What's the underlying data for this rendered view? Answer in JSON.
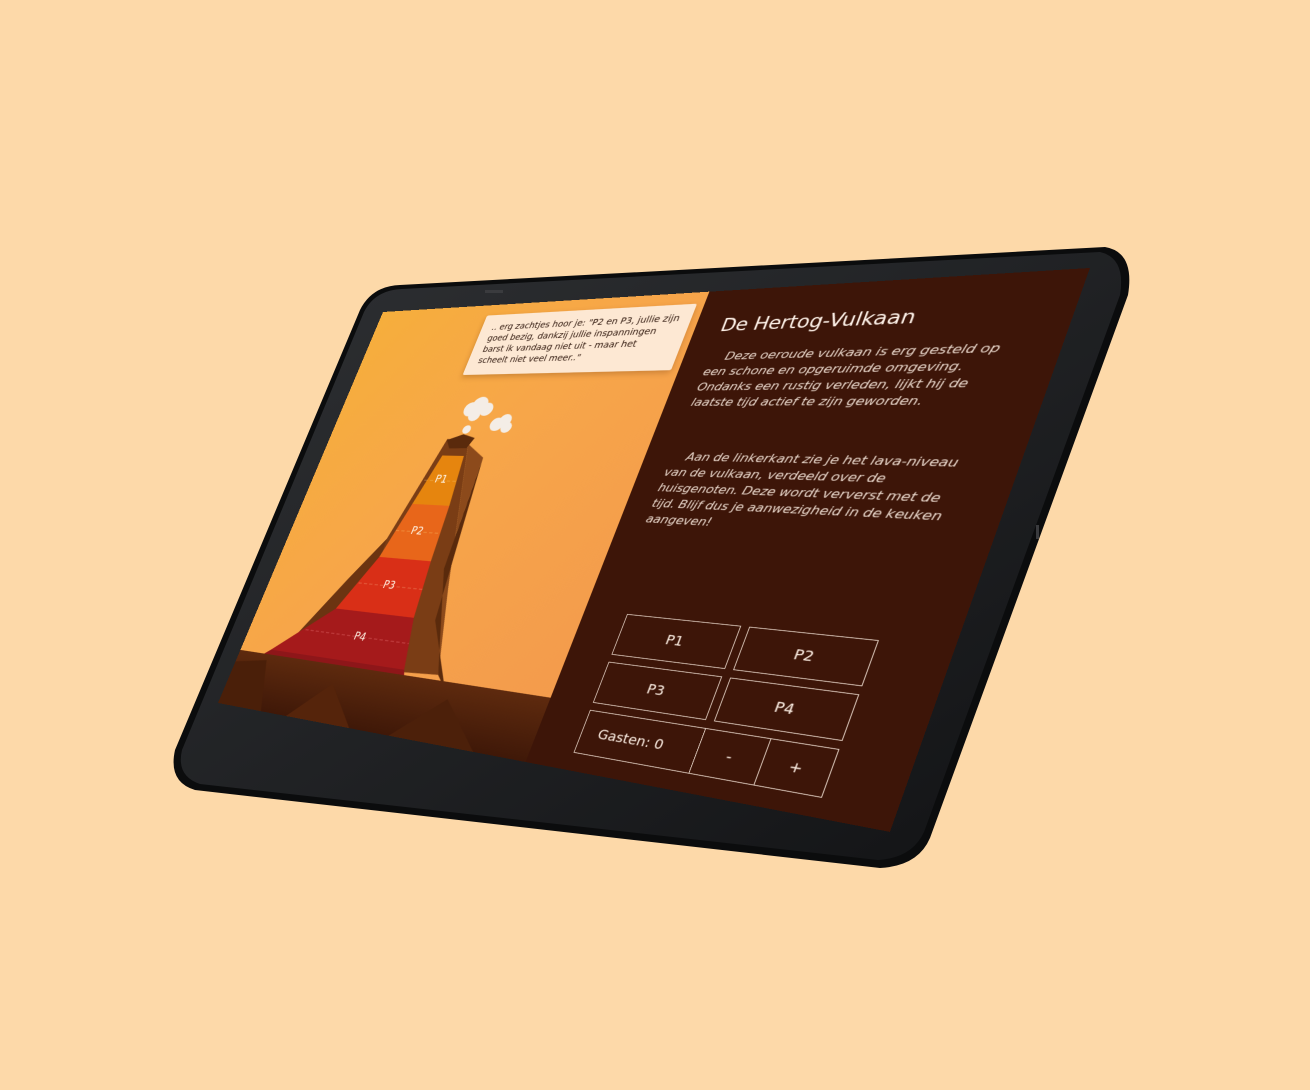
{
  "speech_bubble": {
    "text": ".. erg zachtjes hoor je: \"P2 en P3, jullie zijn goed bezig, dankzij jullie inspanningen barst ik vandaag niet uit - maar het scheelt niet veel meer..\""
  },
  "lava_levels": [
    {
      "label": "P1"
    },
    {
      "label": "P2"
    },
    {
      "label": "P3"
    },
    {
      "label": "P4"
    }
  ],
  "info": {
    "title": "De Hertog-Vulkaan",
    "paragraph1": "Deze oeroude vulkaan is erg gesteld op een schone en opgeruimde omgeving. Ondanks een rustig verleden, lijkt hij de laatste tijd actief te zijn geworden.",
    "paragraph2": "Aan de linkerkant zie je het lava-niveau van de vulkaan, verdeeld over de huisgenoten. Deze wordt ververst met de tijd. Blijf dus je aanwezigheid in de keuken aangeven!"
  },
  "controls": {
    "p1": "P1",
    "p2": "P2",
    "p3": "P3",
    "p4": "P4",
    "guests_label": "Gasten: 0",
    "minus": "-",
    "plus": "+"
  },
  "colors": {
    "background": "#fdd9a9",
    "sky": "#f6ae3c",
    "panel": "#3d1508",
    "lava_p1": "#e6850e",
    "lava_p2": "#e8661a",
    "lava_p3": "#d92f17",
    "lava_p4": "#a51a1b"
  }
}
